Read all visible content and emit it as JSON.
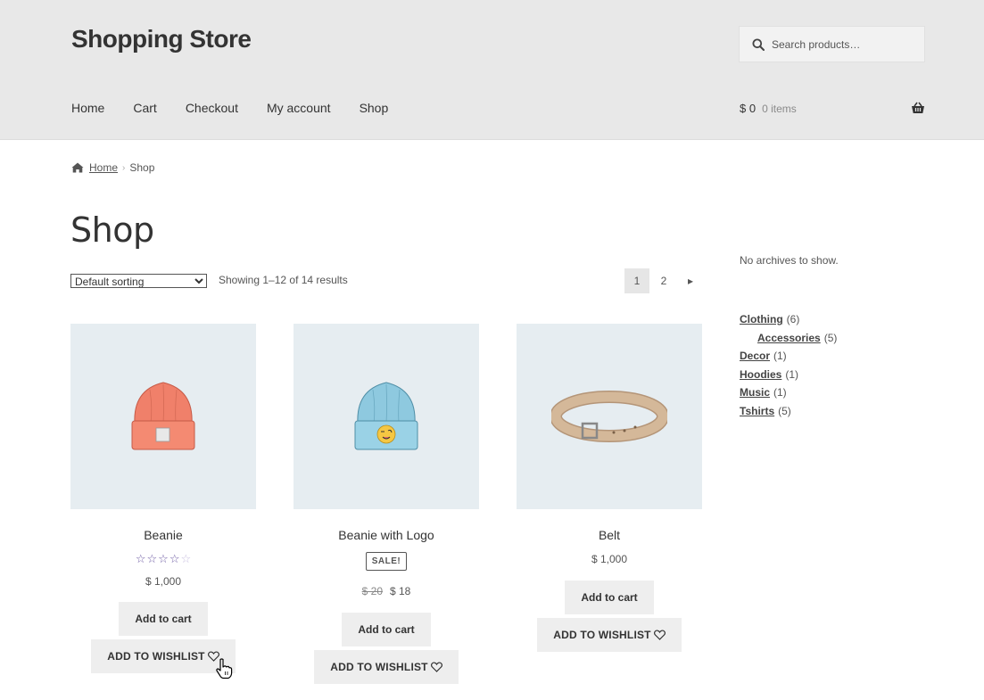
{
  "header": {
    "site_title": "Shopping Store",
    "search_placeholder": "Search products…",
    "nav": [
      "Home",
      "Cart",
      "Checkout",
      "My account",
      "Shop"
    ],
    "cart_amount": "$ 0",
    "cart_count": "0 items"
  },
  "breadcrumb": {
    "home": "Home",
    "separator": "›",
    "current": "Shop"
  },
  "page_title": "Shop",
  "toolbar": {
    "sorting_selected": "Default sorting",
    "result_count": "Showing 1–12 of 14 results",
    "pages": [
      "1",
      "2"
    ],
    "next_label": "▸"
  },
  "products": [
    {
      "name": "Beanie",
      "rating": 3.5,
      "price": "$ 1,000",
      "add_to_cart": "Add to cart",
      "wishlist": "ADD TO WISHLIST",
      "image_icon": "beanie-orange-icon"
    },
    {
      "name": "Beanie with Logo",
      "sale_badge": "SALE!",
      "old_price": "$ 20",
      "price": "$ 18",
      "add_to_cart": "Add to cart",
      "wishlist": "ADD TO WISHLIST",
      "image_icon": "beanie-blue-logo-icon"
    },
    {
      "name": "Belt",
      "price": "$ 1,000",
      "add_to_cart": "Add to cart",
      "wishlist": "ADD TO WISHLIST",
      "image_icon": "belt-icon"
    }
  ],
  "sidebar": {
    "no_archives": "No archives to show.",
    "categories": [
      {
        "name": "Clothing",
        "count": "(6)"
      },
      {
        "name": "Accessories",
        "count": "(5)"
      },
      {
        "name": "Decor",
        "count": "(1)"
      },
      {
        "name": "Hoodies",
        "count": "(1)"
      },
      {
        "name": "Music",
        "count": "(1)"
      },
      {
        "name": "Tshirts",
        "count": "(5)"
      }
    ]
  },
  "colors": {
    "header_bg": "#e8e8e8",
    "star": "#6d5ba3",
    "product_bg": "#e6edf1",
    "button_bg": "#eeeeee"
  }
}
